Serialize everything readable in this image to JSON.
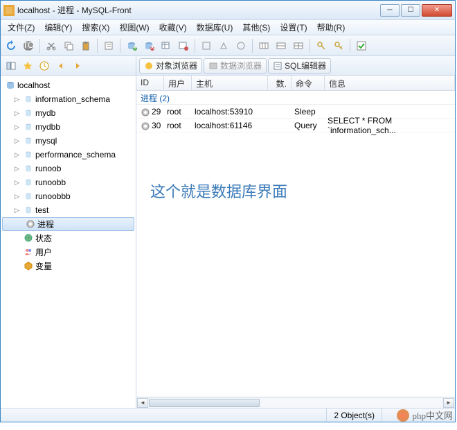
{
  "title": "localhost - 进程 - MySQL-Front",
  "menu": [
    "文件(Z)",
    "编辑(Y)",
    "搜索(X)",
    "视图(W)",
    "收藏(V)",
    "数据库(U)",
    "其他(S)",
    "设置(T)",
    "帮助(R)"
  ],
  "tabs": {
    "object_browser": "对象浏览器",
    "data_browser": "数据浏览器",
    "sql_editor": "SQL编辑器"
  },
  "tree": {
    "root": "localhost",
    "dbs": [
      "information_schema",
      "mydb",
      "mydbb",
      "mysql",
      "performance_schema",
      "runoob",
      "runoobb",
      "runoobbb",
      "test"
    ],
    "process": "进程",
    "status": "状态",
    "users": "用户",
    "variables": "变量"
  },
  "columns": {
    "id": "ID",
    "user": "用户",
    "host": "主机",
    "db": "数.",
    "cmd": "命令",
    "info": "信息"
  },
  "group": "进程 (2)",
  "rows": [
    {
      "id": "29",
      "user": "root",
      "host": "localhost:53910",
      "cmd": "Sleep",
      "info": ""
    },
    {
      "id": "30",
      "user": "root",
      "host": "localhost:61146",
      "cmd": "Query",
      "info": "SELECT * FROM `information_sch..."
    }
  ],
  "annotation": "这个就是数据库界面",
  "status": {
    "objects": "2 Object(s)"
  },
  "watermark": "php中文网"
}
